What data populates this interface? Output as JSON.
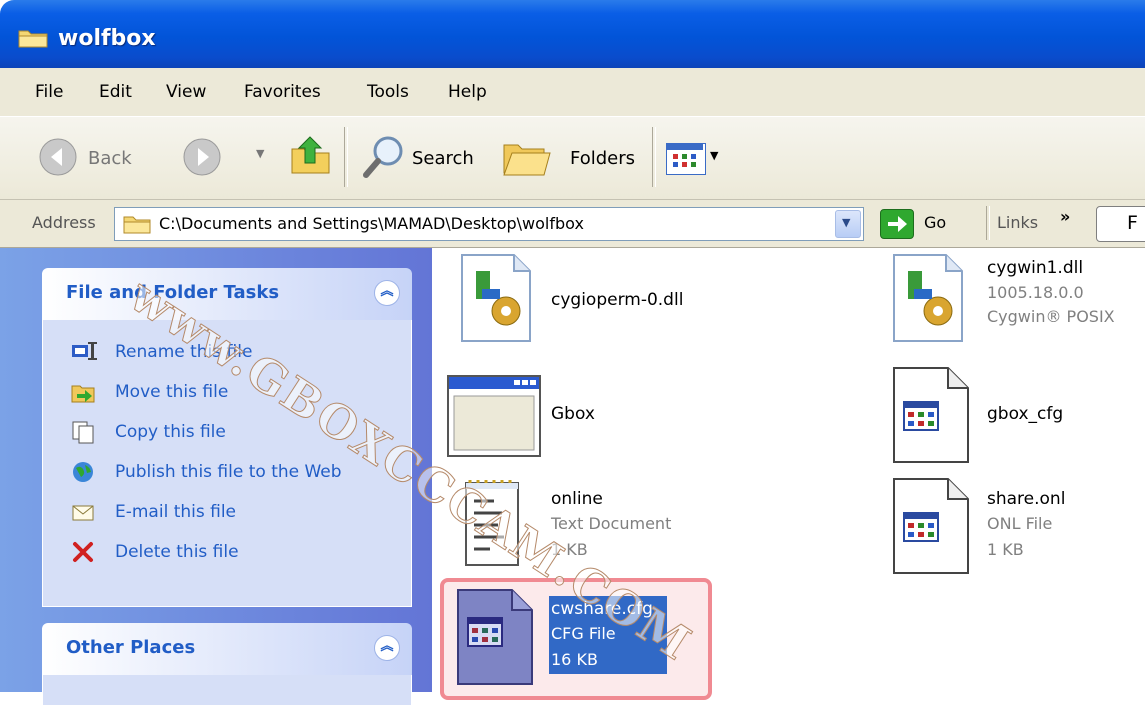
{
  "window": {
    "title": "wolfbox"
  },
  "menu": [
    "File",
    "Edit",
    "View",
    "Favorites",
    "Tools",
    "Help"
  ],
  "toolbar": {
    "back_label": "Back",
    "search_label": "Search",
    "folders_label": "Folders"
  },
  "address": {
    "label": "Address",
    "path": "C:\\Documents and Settings\\MAMAD\\Desktop\\wolfbox",
    "go_label": "Go",
    "links_label": "Links",
    "chevron": "»"
  },
  "tasks_panel": {
    "title": "File and Folder Tasks",
    "items": [
      {
        "label": "Rename this file",
        "icon": "rename-icon"
      },
      {
        "label": "Move this file",
        "icon": "move-icon"
      },
      {
        "label": "Copy this file",
        "icon": "copy-icon"
      },
      {
        "label": "Publish this file to the Web",
        "icon": "publish-icon"
      },
      {
        "label": "E-mail this file",
        "icon": "email-icon"
      },
      {
        "label": "Delete this file",
        "icon": "delete-icon"
      }
    ]
  },
  "other_places": {
    "title": "Other Places"
  },
  "files": [
    {
      "name": "cygioperm-0.dll",
      "type": "",
      "size": "",
      "icon": "dll-icon"
    },
    {
      "name": "cygwin1.dll",
      "type": "1005.18.0.0",
      "size": "Cygwin® POSIX",
      "icon": "dll-icon"
    },
    {
      "name": "Gbox",
      "type": "",
      "size": "",
      "icon": "application-icon"
    },
    {
      "name": "gbox_cfg",
      "type": "",
      "size": "",
      "icon": "config-file-icon"
    },
    {
      "name": "online",
      "type": "Text Document",
      "size": "1 KB",
      "icon": "text-document-icon"
    },
    {
      "name": "share.onl",
      "type": "ONL File",
      "size": "1 KB",
      "icon": "config-file-icon"
    },
    {
      "name": "cwshare.cfg",
      "type": "CFG File",
      "size": "16 KB",
      "icon": "config-file-icon",
      "selected": true
    }
  ],
  "watermark": "www.GBOXCCCAM.COM",
  "colors": {
    "titlebar": "#0254d8",
    "task_link": "#215dc6",
    "selection": "#3169c6",
    "highlight": "#f08a92"
  }
}
